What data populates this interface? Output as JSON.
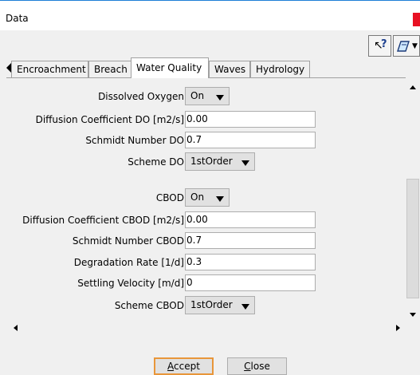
{
  "window": {
    "title": "Data"
  },
  "tabs": [
    {
      "label": "Encroachment"
    },
    {
      "label": "Breach"
    },
    {
      "label": "Water Quality"
    },
    {
      "label": "Waves"
    },
    {
      "label": "Hydrology"
    }
  ],
  "active_tab": "Water Quality",
  "form": {
    "dissolved_oxygen": {
      "label": "Dissolved Oxygen",
      "value": "On"
    },
    "diffusion_do": {
      "label": "Diffusion Coefficient DO [m2/s]",
      "value": "0.00"
    },
    "schmidt_do": {
      "label": "Schmidt Number DO",
      "value": "0.7"
    },
    "scheme_do": {
      "label": "Scheme DO",
      "value": "1stOrder"
    },
    "cbod": {
      "label": "CBOD",
      "value": "On"
    },
    "diffusion_cbod": {
      "label": "Diffusion Coefficient CBOD [m2/s]",
      "value": "0.00"
    },
    "schmidt_cbod": {
      "label": "Schmidt Number CBOD",
      "value": "0.7"
    },
    "degradation_rate": {
      "label": "Degradation Rate [1/d]",
      "value": "0.3"
    },
    "settling_velocity": {
      "label": "Settling Velocity [m/d]",
      "value": "0"
    },
    "scheme_cbod": {
      "label": "Scheme CBOD",
      "value": "1stOrder"
    }
  },
  "buttons": {
    "accept": {
      "first": "A",
      "rest": "ccept"
    },
    "close": {
      "first": "C",
      "rest": "lose"
    }
  },
  "icons": [
    "help-pointer-icon",
    "options-icon",
    "tab-scroll-left-icon",
    "scroll-up-icon",
    "scroll-down-icon",
    "scroll-left-icon",
    "scroll-right-icon"
  ],
  "colors": {
    "accent": "#1e7fd6",
    "close": "#e81123",
    "default_button_border": "#e8963a"
  }
}
